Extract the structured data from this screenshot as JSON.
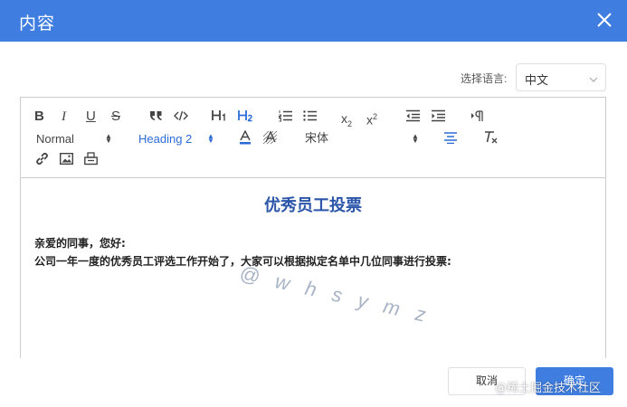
{
  "dialog": {
    "title": "内容"
  },
  "language": {
    "label": "选择语言:",
    "selected": "中文"
  },
  "toolbar": {
    "bold": "B",
    "italic": "I",
    "underline": "U",
    "strike": "S",
    "blockquote": "99",
    "code": "</>",
    "h1": "H1",
    "h2": "H2",
    "subscript": "x2",
    "superscript": "x2",
    "size_select": "Normal",
    "header_select": "Heading 2",
    "font_select": "宋体"
  },
  "document": {
    "title": "优秀员工投票",
    "greeting": "亲爱的同事，您好:",
    "body": "公司一年一度的优秀员工评选工作开始了，大家可以根据拟定名单中几位同事进行投票:"
  },
  "watermark": "@ w h s y m z",
  "footer": {
    "cancel": "取消",
    "ok": "确定"
  },
  "brand_watermark": "@稀土掘金技术社区",
  "colors": {
    "header_bg": "#3f7ee0",
    "accent": "#2c6bd6",
    "title": "#2a55a8"
  }
}
